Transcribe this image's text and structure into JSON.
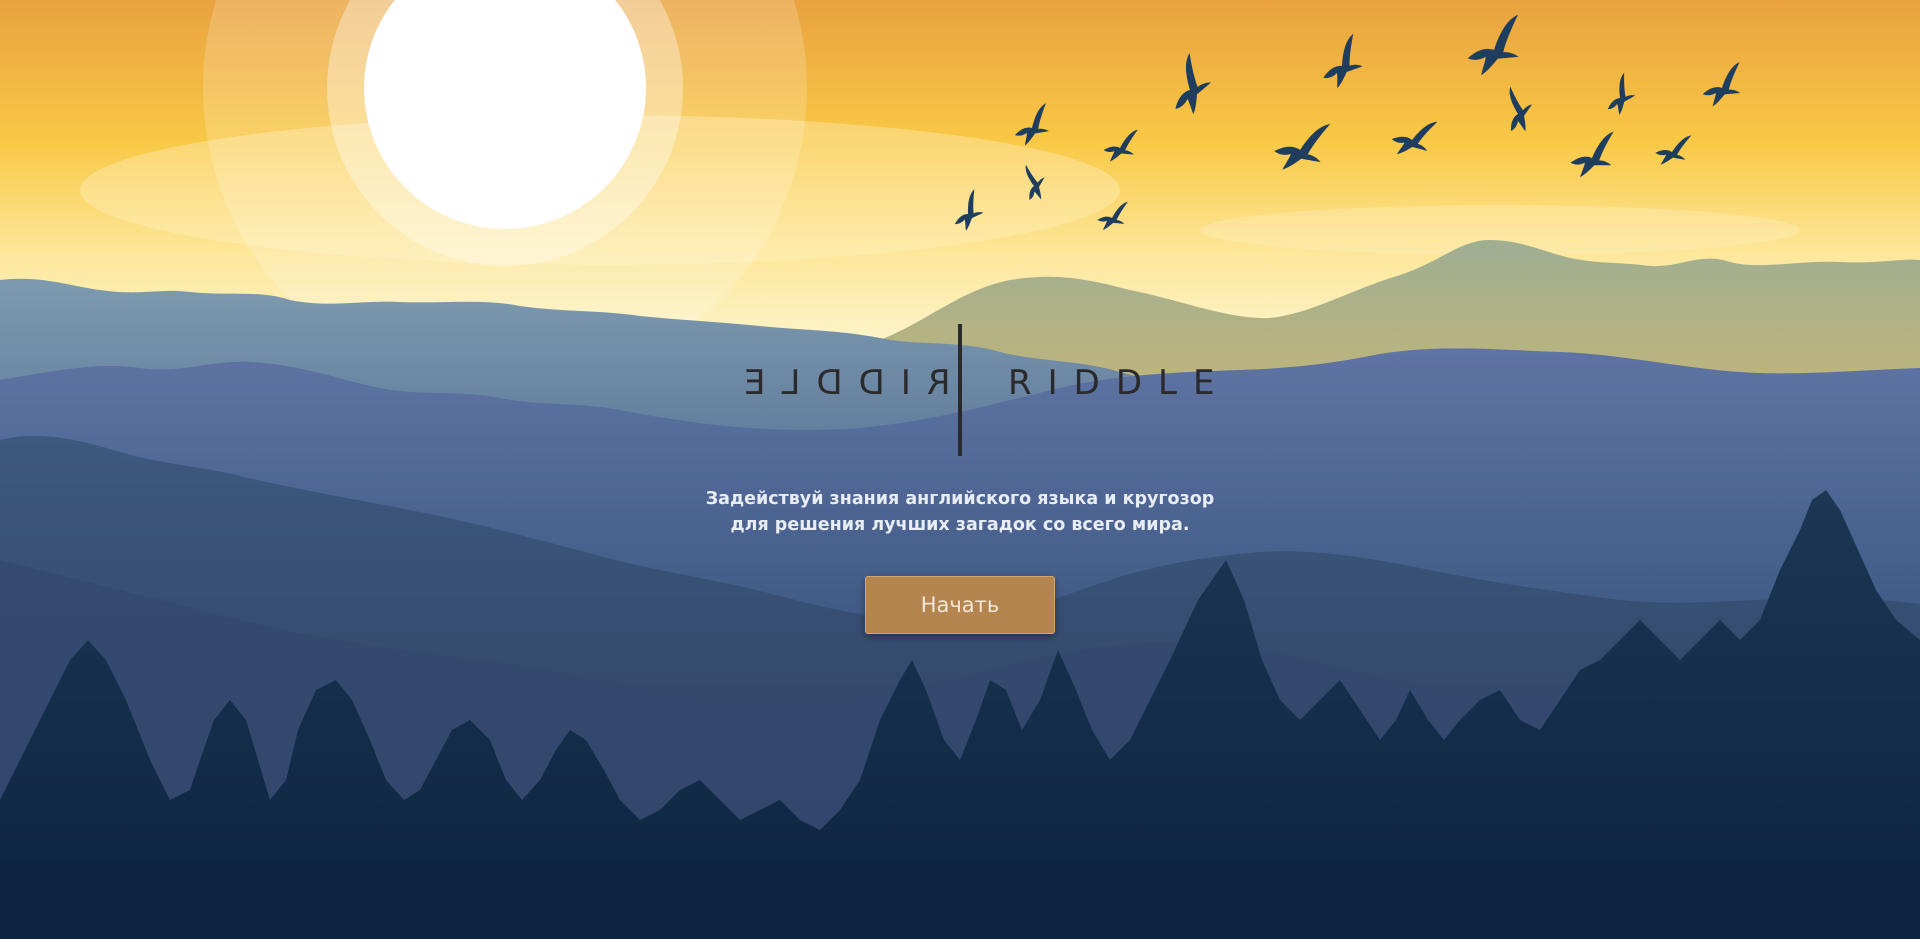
{
  "logo": {
    "word": "RIDDLE",
    "mirrored_word": "RIDDLE"
  },
  "hero": {
    "tagline_line1": "Задействуй знания английского языка и кругозор",
    "tagline_line2": "для решения лучших загадок со всего мира.",
    "start_label": "Начать"
  },
  "colors": {
    "sky_top": "#e9a240",
    "sky_bottom": "#fdf3c8",
    "sun": "#ffffff",
    "birds": "#1f3e5e",
    "far_hills": "#b3b58a",
    "mid_mountains": "#6f8ea8",
    "blue_mountains": "#5d73a3",
    "dark_mountains": "#32486b",
    "forest": "#142c47",
    "button": "#b58550",
    "logo_ink": "#2a2a2c",
    "tagline": "#e8ecf3"
  },
  "icons": {
    "sun": "sun-icon",
    "bird": "bird-icon",
    "tree": "pine-tree-icon"
  }
}
